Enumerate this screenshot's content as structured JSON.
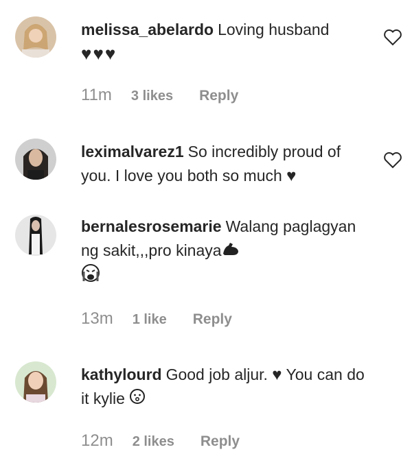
{
  "comments": [
    {
      "username": "melissa_abelardo",
      "text": "Loving husband",
      "emoji_line": "♥♥♥",
      "time": "11m",
      "likes": "3 likes",
      "reply": "Reply"
    },
    {
      "username": "leximalvarez1",
      "text": "So incredibly proud of you. I love you both so much",
      "emoji": "♥"
    },
    {
      "username": "bernalesrosemarie",
      "text": "Walang paglagyan ng sakit,,,pro kinaya",
      "time": "13m",
      "likes": "1 like",
      "reply": "Reply"
    },
    {
      "username": "kathylourd",
      "text": "Good job aljur.",
      "text2": "You can do it kylie",
      "emoji": "♥",
      "time": "12m",
      "likes": "2 likes",
      "reply": "Reply"
    }
  ],
  "icons": {
    "like": "heart-outline-icon",
    "black_heart": "black-heart-emoji",
    "muscle": "flexed-biceps-emoji",
    "crying": "crying-face-emoji",
    "surprised": "hushed-face-emoji"
  }
}
